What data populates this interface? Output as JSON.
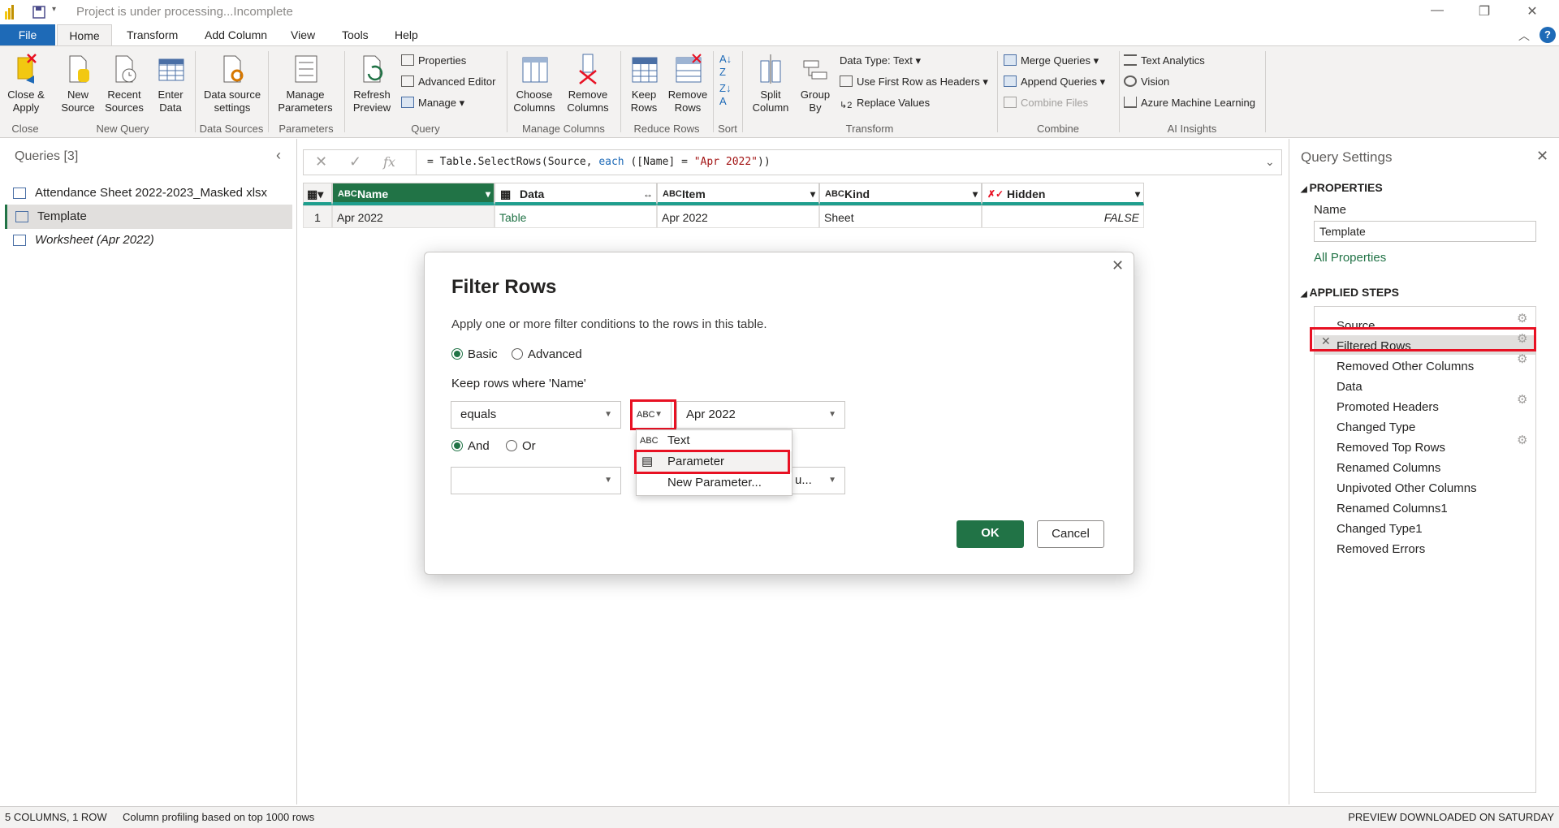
{
  "titlebar": {
    "title": "Project is under processing...Incomplete"
  },
  "tabs": [
    "File",
    "Home",
    "Transform",
    "Add Column",
    "View",
    "Tools",
    "Help"
  ],
  "ribbon": {
    "close_apply": "Close &\nApply",
    "new_source": "New\nSource",
    "recent_sources": "Recent\nSources",
    "enter_data": "Enter\nData",
    "data_source_settings": "Data source\nsettings",
    "manage_parameters": "Manage\nParameters",
    "refresh_preview": "Refresh\nPreview",
    "properties": "Properties",
    "advanced_editor": "Advanced Editor",
    "manage": "Manage",
    "choose_columns": "Choose\nColumns",
    "remove_columns": "Remove\nColumns",
    "keep_rows": "Keep\nRows",
    "remove_rows": "Remove\nRows",
    "split_column": "Split\nColumn",
    "group_by": "Group\nBy",
    "data_type": "Data Type: Text",
    "use_first_row": "Use First Row as Headers",
    "replace_values": "Replace Values",
    "merge_queries": "Merge Queries",
    "append_queries": "Append Queries",
    "combine_files": "Combine Files",
    "text_analytics": "Text Analytics",
    "vision": "Vision",
    "azure_ml": "Azure Machine Learning",
    "groups": [
      "Close",
      "New Query",
      "Data Sources",
      "Parameters",
      "Query",
      "Manage Columns",
      "Reduce Rows",
      "Sort",
      "Transform",
      "Combine",
      "AI Insights"
    ]
  },
  "queries": {
    "header": "Queries [3]",
    "items": [
      "Attendance Sheet 2022-2023_Masked xlsx",
      "Template",
      "Worksheet (Apr 2022)"
    ]
  },
  "formula": {
    "prefix": "= Table.SelectRows(Source, ",
    "keyword": "each",
    "middle": " ([Name] = ",
    "string": "\"Apr 2022\"",
    "suffix": "))"
  },
  "grid": {
    "columns": [
      "Name",
      "Data",
      "Item",
      "Kind",
      "Hidden"
    ],
    "row_number": "1",
    "row": [
      "Apr 2022",
      "Table",
      "Apr 2022",
      "Sheet",
      "FALSE"
    ]
  },
  "settings": {
    "title": "Query Settings",
    "properties_header": "PROPERTIES",
    "name_label": "Name",
    "name_value": "Template",
    "all_properties": "All Properties",
    "applied_steps_header": "APPLIED STEPS",
    "steps": [
      "Source",
      "Filtered Rows",
      "Removed Other Columns",
      "Data",
      "Promoted Headers",
      "Changed Type",
      "Removed Top Rows",
      "Renamed Columns",
      "Unpivoted Other Columns",
      "Renamed Columns1",
      "Changed Type1",
      "Removed Errors"
    ]
  },
  "status": {
    "left": "5 COLUMNS, 1 ROW",
    "profiling": "Column profiling based on top 1000 rows",
    "right": "PREVIEW DOWNLOADED ON SATURDAY"
  },
  "dialog": {
    "title": "Filter Rows",
    "description": "Apply one or more filter conditions to the rows in this table.",
    "basic": "Basic",
    "advanced": "Advanced",
    "keep_rows": "Keep rows where 'Name'",
    "operator": "equals",
    "value": "Apr 2022",
    "and": "And",
    "or": "Or",
    "value2_partial": "u...",
    "ok": "OK",
    "cancel": "Cancel",
    "menu": [
      "Text",
      "Parameter",
      "New Parameter..."
    ]
  },
  "colors": {
    "accent": "#217346",
    "file_tab": "#1e6ab7",
    "highlight": "#e81123",
    "teal": "#1e9e8d"
  }
}
